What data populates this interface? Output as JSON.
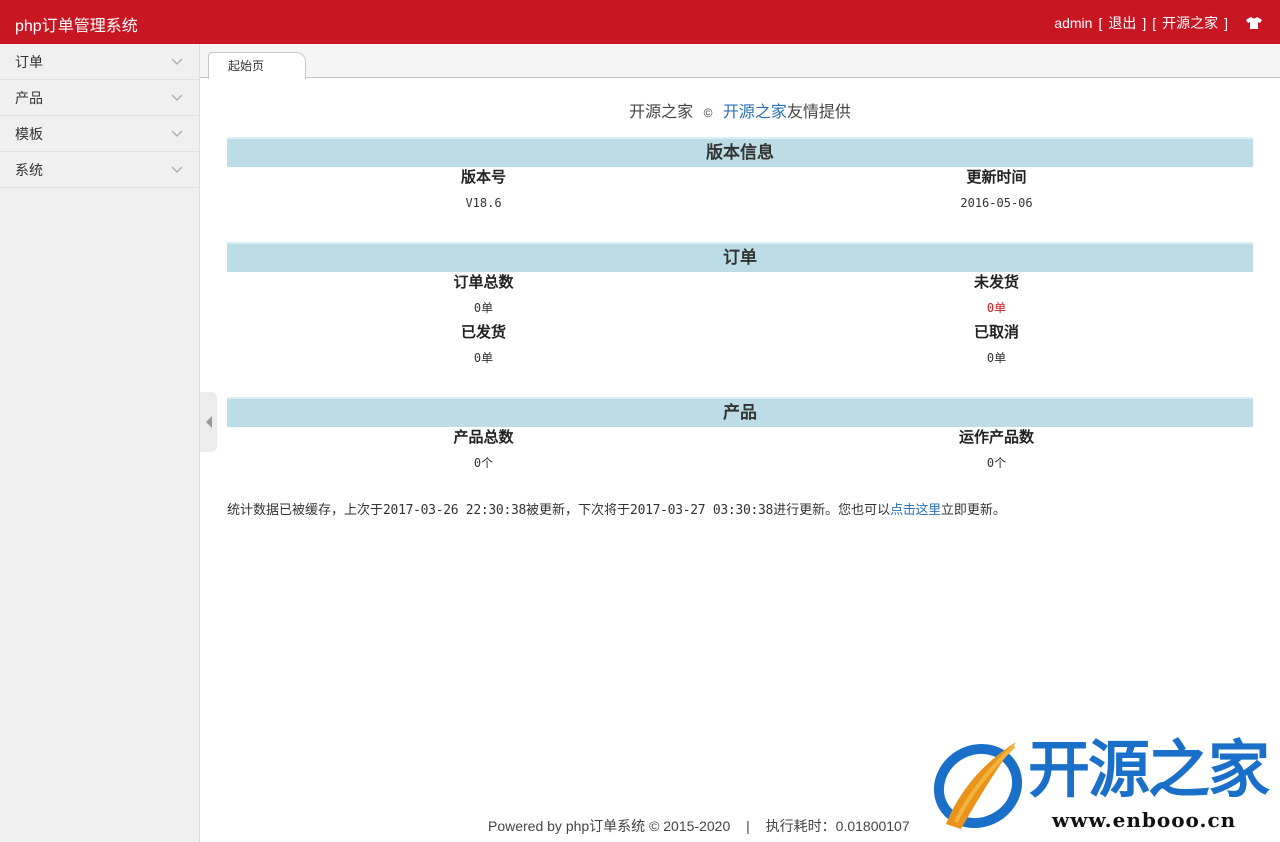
{
  "header": {
    "app_title": "php订单管理系统",
    "user": "admin",
    "bracket_open": "[",
    "bracket_close": "]",
    "logout": "退出",
    "site_link": "开源之家",
    "icon": "shirt-icon"
  },
  "sidebar": {
    "items": [
      {
        "label": "订单",
        "icon": "chevron-down-icon"
      },
      {
        "label": "产品",
        "icon": "chevron-down-icon"
      },
      {
        "label": "模板",
        "icon": "chevron-down-icon"
      },
      {
        "label": "系统",
        "icon": "chevron-down-icon"
      }
    ]
  },
  "tabs": [
    {
      "label": "起始页",
      "active": true
    }
  ],
  "credits": {
    "prefix": "开源之家",
    "copyright": "©",
    "link": "开源之家",
    "suffix": "友情提供"
  },
  "sections": {
    "version": {
      "title": "版本信息",
      "cells": [
        {
          "label": "版本号",
          "value": "V18.6"
        },
        {
          "label": "更新时间",
          "value": "2016-05-06"
        }
      ]
    },
    "orders": {
      "title": "订单",
      "cells": [
        {
          "label": "订单总数",
          "value": "0单"
        },
        {
          "label": "未发货",
          "value": "0单"
        },
        {
          "label": "已发货",
          "value": "0单"
        },
        {
          "label": "已取消",
          "value": "0单"
        }
      ]
    },
    "products": {
      "title": "产品",
      "cells": [
        {
          "label": "产品总数",
          "value": "0个"
        },
        {
          "label": "运作产品数",
          "value": "0个"
        }
      ]
    }
  },
  "note": {
    "part1": "统计数据已被缓存，上次于",
    "last_time": "2017-03-26 22:30:38",
    "part2": "被更新，下次将于",
    "next_time": "2017-03-27 03:30:38",
    "part3": "进行更新。您也可以",
    "link": "点击这里",
    "part4": "立即更新。"
  },
  "footer": {
    "powered": "Powered by php订单系统 © 2015-2020",
    "separator": "|",
    "exec_time": "执行耗时：0.01800107"
  },
  "watermark": {
    "text": "开源之家",
    "url": "www.enbooo.cn"
  },
  "colors": {
    "header_bg": "#c91623",
    "section_head_bg": "#bcdde6",
    "link": "#2a6fb4",
    "alert": "#d0191d"
  }
}
